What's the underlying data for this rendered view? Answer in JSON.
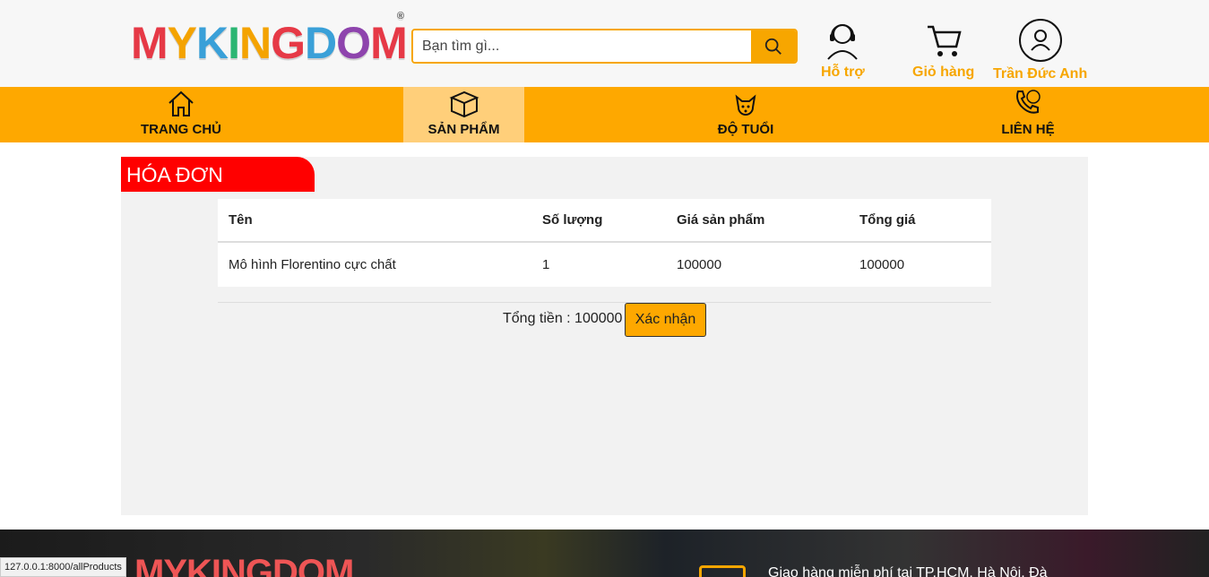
{
  "header": {
    "logo_letters": [
      "M",
      "Y",
      "K",
      "I",
      "N",
      "G",
      "D",
      "O",
      "M"
    ],
    "logo_colors": [
      "#e63946",
      "#f4a300",
      "#3aa0d8",
      "#2bb673",
      "#f4a300",
      "#e63946",
      "#3aa0d8",
      "#8e44ad",
      "#e63946"
    ],
    "search_placeholder": "Bạn tìm gì...",
    "support_label": "Hỗ trợ",
    "cart_label": "Giỏ hàng",
    "user_label": "Trần Đức Anh"
  },
  "nav": {
    "home": "TRANG CHỦ",
    "products": "SẢN PHẨM",
    "age": "ĐỘ TUỔI",
    "contact": "LIÊN HỆ"
  },
  "invoice": {
    "title": "HÓA ĐƠN",
    "columns": [
      "Tên",
      "Số lượng",
      "Giá sản phẩm",
      "Tổng giá"
    ],
    "rows": [
      [
        "Mô hình Florentino cực chất",
        "1",
        "100000",
        "100000"
      ]
    ],
    "total_text": "Tổng tiền : 100000",
    "confirm_label": "Xác nhận"
  },
  "footer": {
    "logo_text": "MYKINGDOM",
    "shipping_text": "Giao hàng miễn phí tại TP.HCM, Hà Nội, Đà"
  },
  "status_url": "127.0.0.1:8000/allProducts",
  "colors": {
    "accent": "#fea800",
    "invoice_tag": "#ff0000",
    "panel_bg": "#f2f2f2"
  }
}
